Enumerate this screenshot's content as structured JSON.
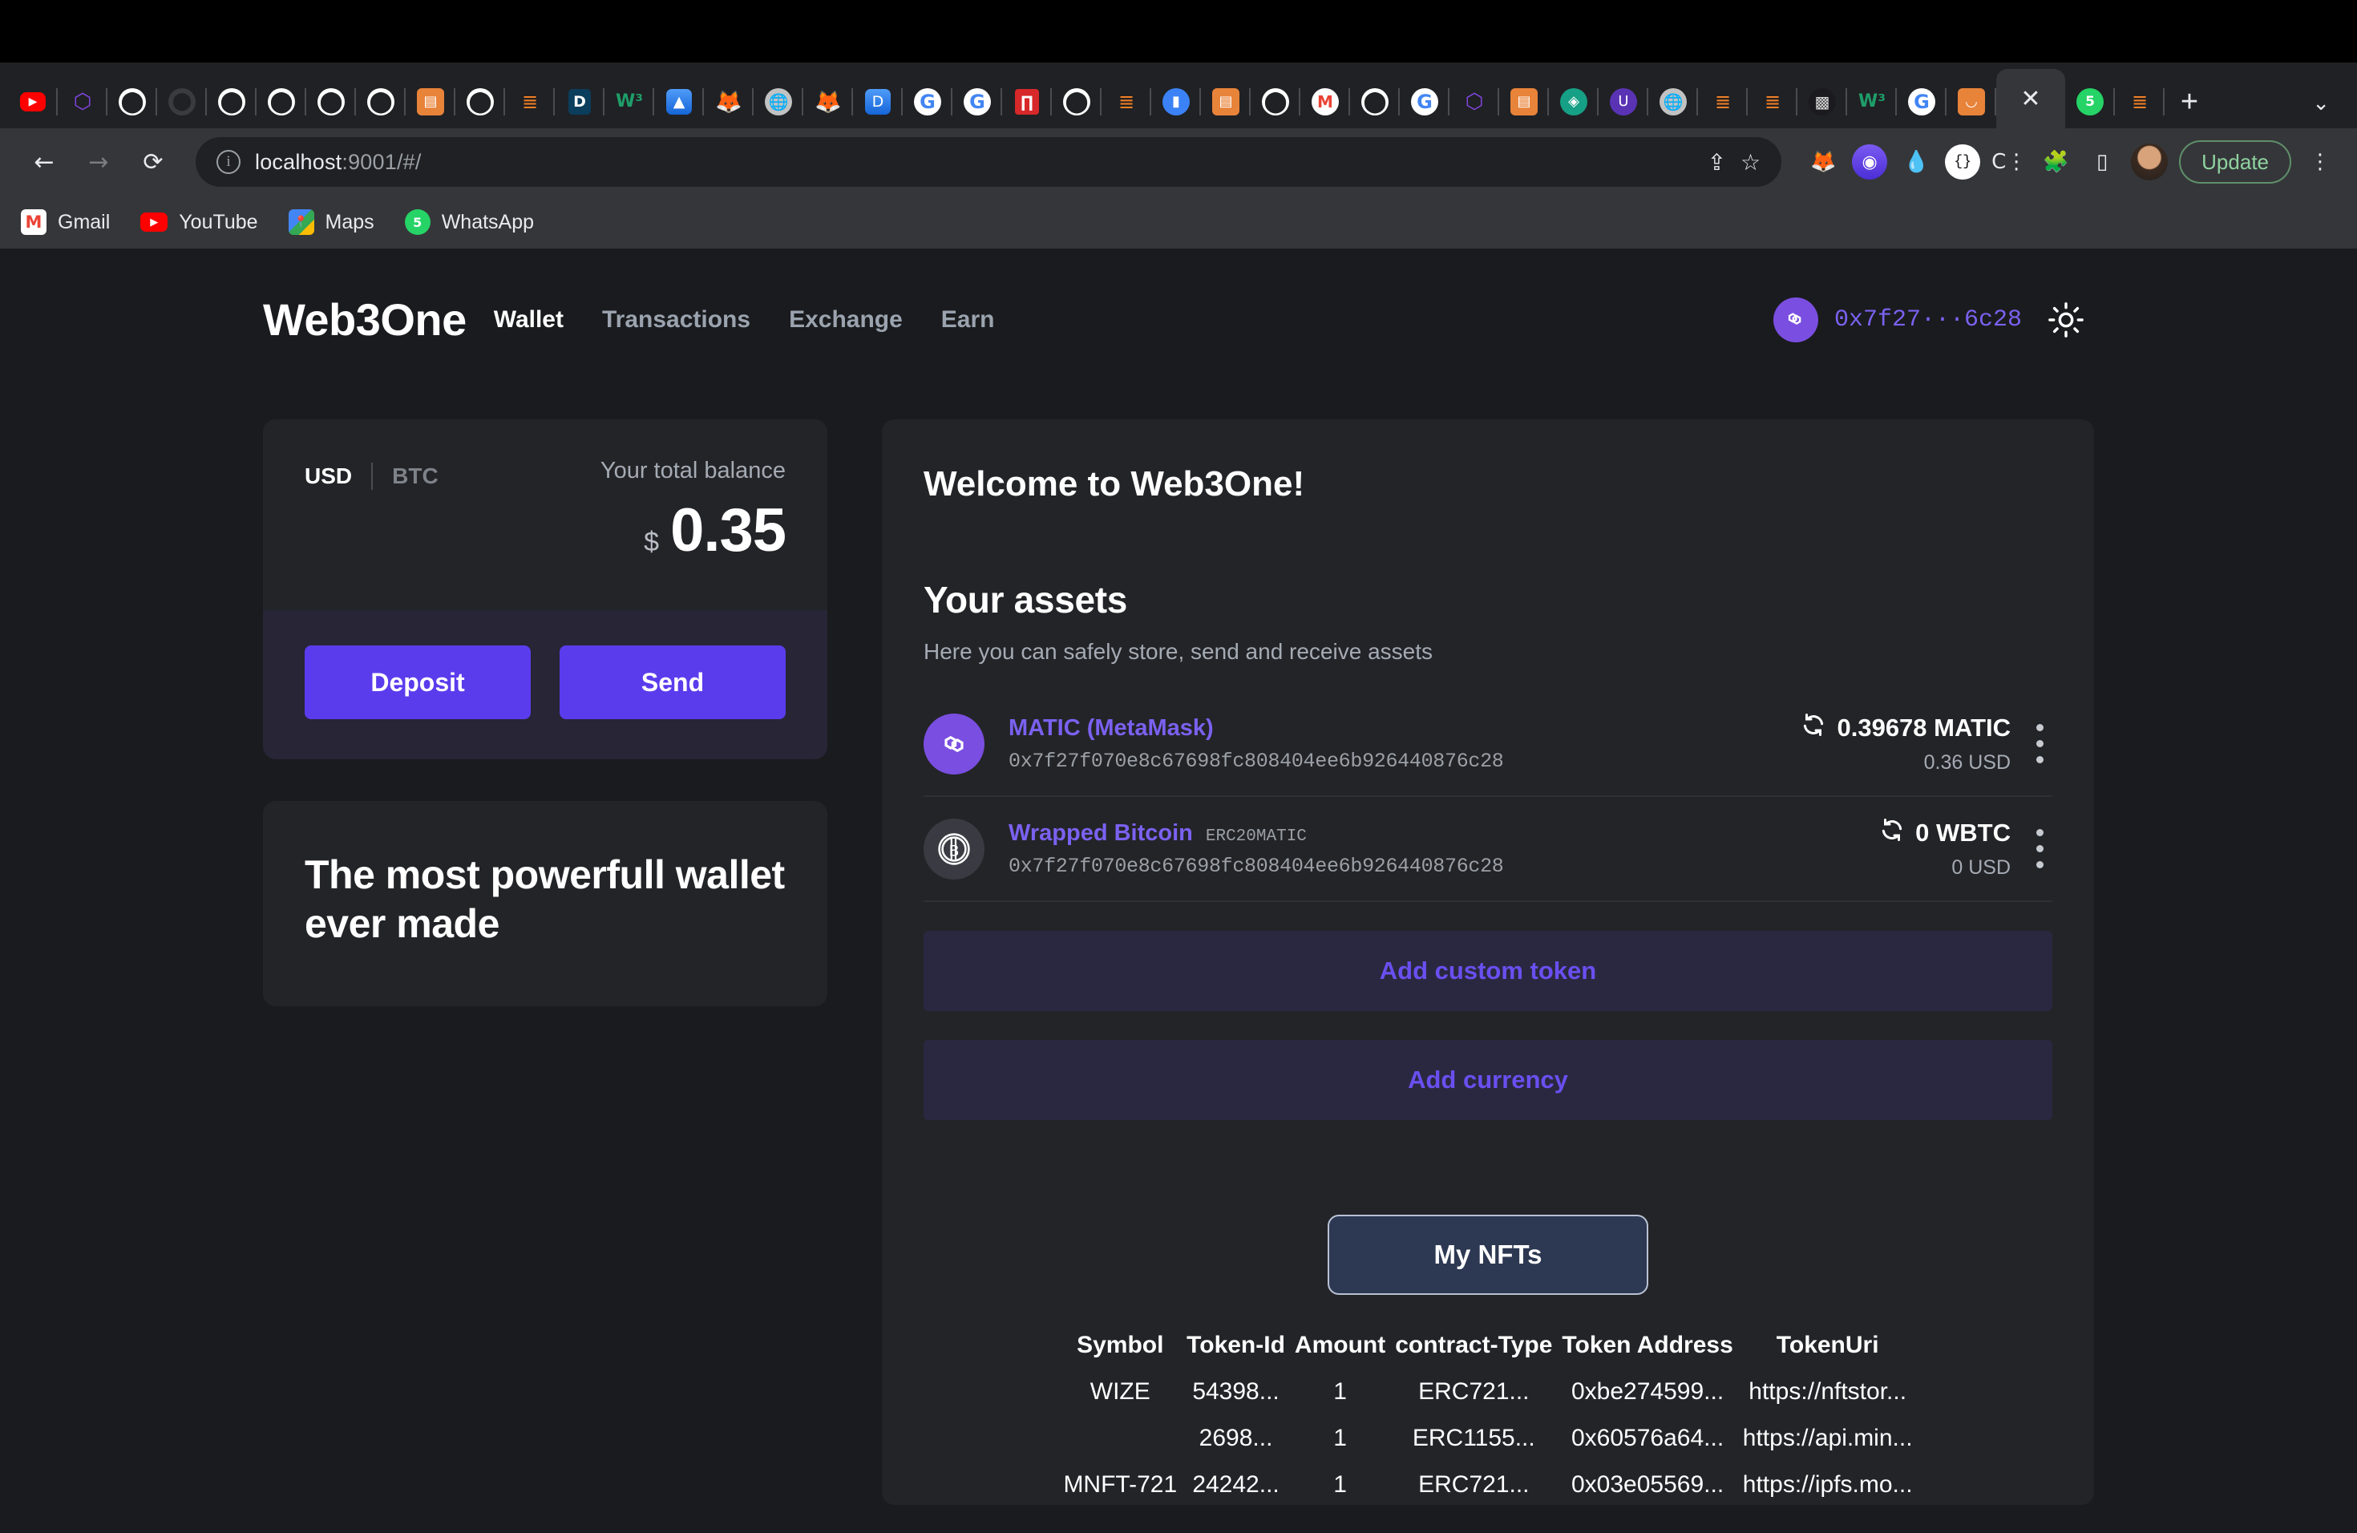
{
  "browser": {
    "url_main": "localhost",
    "url_rest": ":9001/#/",
    "info_icon": "ⓘ",
    "back_icon": "←",
    "forward_icon": "→",
    "reload_icon": "⟳",
    "share_icon": "⇪",
    "star_icon": "☆",
    "update_label": "Update",
    "menu_icon": "⋮",
    "new_tab_icon": "+",
    "tab_list_icon": "⌄",
    "close_tab_icon": "✕",
    "extensions": [
      {
        "name": "metamask-extension-icon",
        "glyph": "🦊"
      },
      {
        "name": "phantom-extension-icon",
        "glyph": "👻"
      },
      {
        "name": "water-drop-extension-icon",
        "glyph": "💧"
      },
      {
        "name": "braces-circle-extension-icon",
        "glyph": "{..}"
      },
      {
        "name": "c-extension-icon",
        "glyph": "C⋮"
      },
      {
        "name": "puzzle-extensions-icon",
        "glyph": "🧩"
      },
      {
        "name": "side-panel-icon",
        "glyph": "▯"
      }
    ],
    "bookmarks": [
      {
        "label": "Gmail",
        "icon": "gmail-icon",
        "glyph": "M"
      },
      {
        "label": "YouTube",
        "icon": "youtube-icon",
        "glyph": "▶"
      },
      {
        "label": "Maps",
        "icon": "maps-icon",
        "glyph": "📍"
      },
      {
        "label": "WhatsApp",
        "icon": "whatsapp-icon",
        "glyph": "5"
      }
    ],
    "tabs": [
      {
        "name": "tab-youtube",
        "icon": "youtube-icon",
        "cls": "fav-yt",
        "glyph": "▶"
      },
      {
        "name": "tab-polygon",
        "icon": "polygon-icon",
        "cls": "fav-poly",
        "glyph": "⬡"
      },
      {
        "name": "tab-github-1",
        "icon": "github-icon",
        "cls": "fav-gh",
        "glyph": "⬤"
      },
      {
        "name": "tab-github-dim",
        "icon": "github-icon",
        "cls": "fav-gh-dim",
        "glyph": "⬤"
      },
      {
        "name": "tab-github-2",
        "icon": "github-icon",
        "cls": "fav-gh",
        "glyph": "⬤"
      },
      {
        "name": "tab-github-3",
        "icon": "github-icon",
        "cls": "fav-gh",
        "glyph": "⬤"
      },
      {
        "name": "tab-github-4",
        "icon": "github-icon",
        "cls": "fav-gh",
        "glyph": "⬤"
      },
      {
        "name": "tab-github-5",
        "icon": "github-icon",
        "cls": "fav-gh",
        "glyph": "⬤"
      },
      {
        "name": "tab-wallet",
        "icon": "wallet-icon",
        "cls": "fav-orange",
        "glyph": "▤"
      },
      {
        "name": "tab-github-6",
        "icon": "github-icon",
        "cls": "fav-gh",
        "glyph": "⬤"
      },
      {
        "name": "tab-stackoverflow-1",
        "icon": "stackoverflow-icon",
        "cls": "fav-so",
        "glyph": "≣"
      },
      {
        "name": "tab-d-site",
        "icon": "d-icon",
        "cls": "fav-d",
        "glyph": "D"
      },
      {
        "name": "tab-w3schools",
        "icon": "w3-icon",
        "cls": "fav-w3",
        "glyph": "W³"
      },
      {
        "name": "tab-blue-app",
        "icon": "blue-app-icon",
        "cls": "fav-blue",
        "glyph": "▲"
      },
      {
        "name": "tab-metamask-1",
        "icon": "metamask-icon",
        "cls": "fav-mm",
        "glyph": "🦊"
      },
      {
        "name": "tab-globe",
        "icon": "globe-icon",
        "cls": "fav-gray",
        "glyph": "🌐"
      },
      {
        "name": "tab-metamask-2",
        "icon": "metamask-icon",
        "cls": "fav-mm",
        "glyph": "🦊"
      },
      {
        "name": "tab-dapp",
        "icon": "dapp-icon",
        "cls": "fav-blue",
        "glyph": "D"
      },
      {
        "name": "tab-google-1",
        "icon": "google-icon",
        "cls": "fav-gg",
        "glyph": "G"
      },
      {
        "name": "tab-google-2",
        "icon": "google-icon",
        "cls": "fav-gg",
        "glyph": "G"
      },
      {
        "name": "tab-red-app",
        "icon": "red-app-icon",
        "cls": "fav-red",
        "glyph": "∏"
      },
      {
        "name": "tab-github-7",
        "icon": "github-icon",
        "cls": "fav-gh",
        "glyph": "⬤"
      },
      {
        "name": "tab-stackoverflow-2",
        "icon": "stackoverflow-icon",
        "cls": "fav-so",
        "glyph": "≣"
      },
      {
        "name": "tab-notification",
        "icon": "bell-icon",
        "cls": "fav-bell",
        "glyph": "▮"
      },
      {
        "name": "tab-orange-app",
        "icon": "orange-app-icon",
        "cls": "fav-orange",
        "glyph": "▤"
      },
      {
        "name": "tab-github-8",
        "icon": "github-icon",
        "cls": "fav-gh",
        "glyph": "⬤"
      },
      {
        "name": "tab-gmail",
        "icon": "gmail-icon",
        "cls": "fav-mail",
        "glyph": "M"
      },
      {
        "name": "tab-github-9",
        "icon": "github-icon",
        "cls": "fav-gh",
        "glyph": "⬤"
      },
      {
        "name": "tab-google-3",
        "icon": "google-icon",
        "cls": "fav-gg",
        "glyph": "G"
      },
      {
        "name": "tab-polygon-2",
        "icon": "polygon-icon",
        "cls": "fav-poly",
        "glyph": "⬡"
      },
      {
        "name": "tab-wallet-2",
        "icon": "wallet-icon",
        "cls": "fav-orange",
        "glyph": "▤"
      },
      {
        "name": "tab-opensea",
        "icon": "opensea-icon",
        "cls": "fav-teal",
        "glyph": "◈"
      },
      {
        "name": "tab-uniswap",
        "icon": "uniswap-icon",
        "cls": "fav-purple2",
        "glyph": "U"
      },
      {
        "name": "tab-globe-2",
        "icon": "globe-icon",
        "cls": "fav-gray",
        "glyph": "🌐"
      },
      {
        "name": "tab-stackoverflow-3",
        "icon": "stackoverflow-icon",
        "cls": "fav-so",
        "glyph": "≣"
      },
      {
        "name": "tab-stackoverflow-4",
        "icon": "stackoverflow-icon",
        "cls": "fav-so",
        "glyph": "≣"
      },
      {
        "name": "tab-dark-app",
        "icon": "dark-app-icon",
        "cls": "fav-dark",
        "glyph": "▩"
      },
      {
        "name": "tab-w3schools-2",
        "icon": "w3-icon",
        "cls": "fav-w3",
        "glyph": "W³"
      },
      {
        "name": "tab-google-4",
        "icon": "google-icon",
        "cls": "fav-gg",
        "glyph": "G"
      },
      {
        "name": "tab-tongue-app",
        "icon": "tongue-icon",
        "cls": "fav-orange",
        "glyph": "◡"
      }
    ],
    "tabs_after_active": [
      {
        "name": "tab-whatsapp",
        "icon": "whatsapp-icon",
        "cls": "fav-wa",
        "glyph": "5"
      },
      {
        "name": "tab-stackoverflow-5",
        "icon": "stackoverflow-icon",
        "cls": "fav-so",
        "glyph": "≣"
      }
    ]
  },
  "app": {
    "logo": "Web3One",
    "nav": [
      {
        "label": "Wallet",
        "active": true
      },
      {
        "label": "Transactions",
        "active": false
      },
      {
        "label": "Exchange",
        "active": false
      },
      {
        "label": "Earn",
        "active": false
      }
    ],
    "account": {
      "address_short": "0x7f27···6c28",
      "avatar_icon": "polygon-icon",
      "avatar_glyph": "∞"
    },
    "theme_toggle_icon": "sun-icon"
  },
  "balance_card": {
    "currency_usd": "USD",
    "currency_btc": "BTC",
    "label": "Your total balance",
    "symbol": "$",
    "amount": "0.35",
    "deposit_label": "Deposit",
    "send_label": "Send"
  },
  "promo_card": {
    "text": "The most powerfull wallet ever made"
  },
  "main": {
    "welcome": "Welcome to Web3One!",
    "assets_title": "Your assets",
    "assets_subtitle": "Here you can safely store, send and receive assets",
    "assets": [
      {
        "name": "MATIC (MetaMask)",
        "badge": "",
        "address": "0x7f27f070e8c67698fc808404ee6b926440876c28",
        "quantity": "0.39678 MATIC",
        "usd": "0.36  USD",
        "icon": "polygon-icon",
        "icon_glyph": "∞",
        "icon_class": "ic-matic",
        "refresh_icon": "↻"
      },
      {
        "name": "Wrapped Bitcoin",
        "badge": "ERC20MATIC",
        "address": "0x7f27f070e8c67698fc808404ee6b926440876c28",
        "quantity": "0 WBTC",
        "usd": "0  USD",
        "icon": "bitcoin-icon",
        "icon_glyph": "₿",
        "icon_class": "ic-wbtc",
        "refresh_icon": "↻"
      }
    ],
    "add_custom_token_label": "Add custom token",
    "add_currency_label": "Add currency"
  },
  "nft": {
    "button_label": "My NFTs",
    "columns": [
      "Symbol",
      "Token-Id",
      "Amount",
      "contract-Type",
      "Token Address",
      "TokenUri"
    ],
    "rows": [
      [
        "WIZE",
        "54398...",
        "1",
        "ERC721...",
        "0xbe274599...",
        "https://nftstor..."
      ],
      [
        "",
        "2698...",
        "1",
        "ERC1155...",
        "0x60576a64...",
        "https://api.min..."
      ],
      [
        "MNFT-721",
        "24242...",
        "1",
        "ERC721...",
        "0x03e05569...",
        "https://ipfs.mo..."
      ]
    ]
  },
  "colors": {
    "accent_purple": "#5b3ced",
    "link_purple": "#7b61f0",
    "page_bg": "#1a1b1e",
    "card_bg": "#232428"
  }
}
